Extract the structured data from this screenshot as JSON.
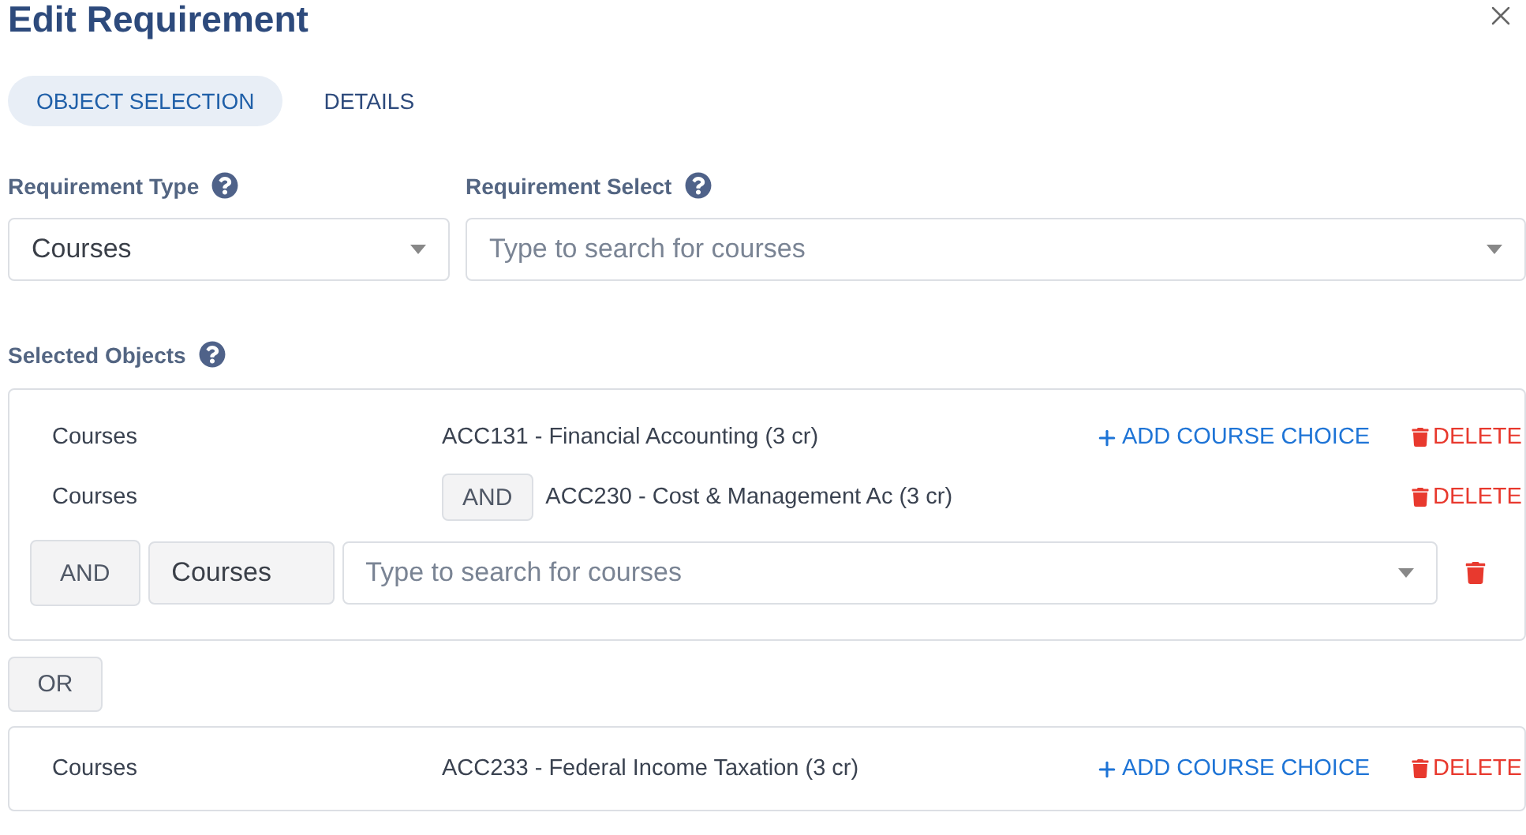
{
  "dialog": {
    "title": "Edit Requirement"
  },
  "tabs": [
    {
      "label": "OBJECT SELECTION",
      "selected": true
    },
    {
      "label": "DETAILS",
      "selected": false
    }
  ],
  "filters": [
    {
      "label": "Requirement Type",
      "value": "Courses"
    },
    {
      "label": "Requirement Select",
      "placeholder": "Type to search for courses"
    }
  ],
  "selected_objects": {
    "label": "Selected Objects",
    "groups": [
      {
        "rows": [
          {
            "type": "Courses",
            "course": "ACC131 - Financial Accounting (3 cr)",
            "add_choice": "ADD COURSE CHOICE",
            "delete": "DELETE"
          },
          {
            "type": "Courses",
            "connector": "AND",
            "course": "ACC230 - Cost & Management Ac (3 cr)",
            "delete": "DELETE"
          }
        ],
        "new_choice": {
          "connector": "AND",
          "type": "Courses",
          "placeholder": "Type to search for courses"
        }
      },
      {
        "separator": "OR",
        "rows": [
          {
            "type": "Courses",
            "course": "ACC233 - Federal Income Taxation (3 cr)",
            "add_choice": "ADD COURSE CHOICE",
            "delete": "DELETE"
          }
        ]
      }
    ]
  }
}
